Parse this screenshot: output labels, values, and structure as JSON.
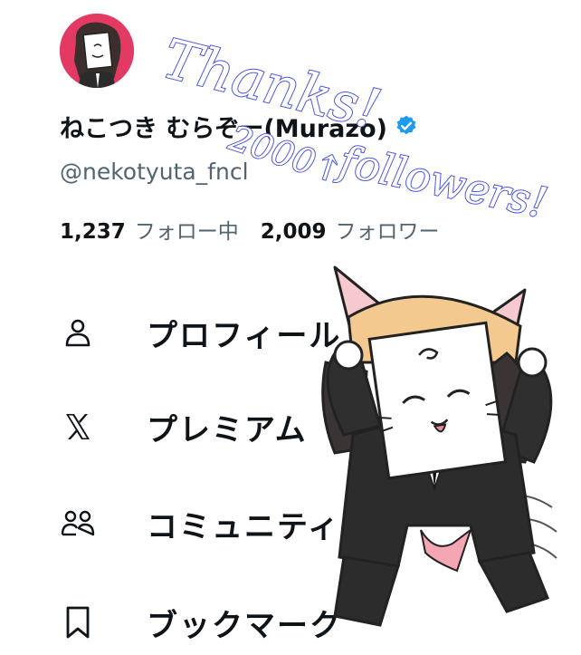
{
  "profile": {
    "display_name": "ねこつき むらぞー(Murazo)",
    "handle": "@nekotyuta_fncl",
    "verified_icon": "verified-badge-icon",
    "following_count": "1,237",
    "following_label": "フォロー中",
    "followers_count": "2,009",
    "followers_label": "フォロワー",
    "avatar_color": "#e23a63"
  },
  "menu": {
    "items": [
      {
        "label": "プロフィール",
        "icon": "person-icon"
      },
      {
        "label": "プレミアム",
        "icon": "x-logo-icon"
      },
      {
        "label": "コミュニティ",
        "icon": "communities-icon"
      },
      {
        "label": "ブックマーク",
        "icon": "bookmark-icon"
      }
    ]
  },
  "overlay": {
    "thanks_text": "Thanks!",
    "count_text": "2000↑",
    "followers_text": "followers!",
    "ink_color": "#4a55e6"
  },
  "colors": {
    "text_primary": "#0f1419",
    "text_secondary": "#536471",
    "verified_blue": "#1d9bf0"
  }
}
